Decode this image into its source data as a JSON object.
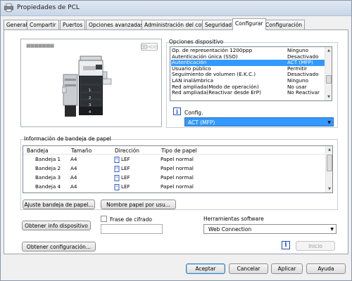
{
  "window": {
    "title": "Propiedades de PCL"
  },
  "tabs": [
    {
      "label": "General"
    },
    {
      "label": "Compartir"
    },
    {
      "label": "Puertos"
    },
    {
      "label": "Opciones avanzadas"
    },
    {
      "label": "Administración del color"
    },
    {
      "label": "Seguridad"
    },
    {
      "label": "Configurar"
    },
    {
      "label": "Configuración"
    }
  ],
  "active_tab": "Configurar",
  "preview": {
    "hdd_label": "HDD",
    "blurred_text": "■■■■■■■",
    "tray_numbers": [
      "1",
      "2",
      "3",
      "4"
    ]
  },
  "device_options": {
    "title": "Opciones dispositivo",
    "items": [
      {
        "name": "Op. de representación 1200ppp",
        "value": "Ninguno"
      },
      {
        "name": "Autenticación única (SSO)",
        "value": "Desactivado"
      },
      {
        "name": "Autenticación",
        "value": "ACT (MFP)"
      },
      {
        "name": "Usuario público",
        "value": "Permitir"
      },
      {
        "name": "Seguimiento de volumen (E.K.C.)",
        "value": "Desactivado"
      },
      {
        "name": "LAN inalámbrica",
        "value": "Ninguno"
      },
      {
        "name": "Red ampliada(Modo de operación)",
        "value": "No usar"
      },
      {
        "name": "Red ampliada(Reactivar desde ErP)",
        "value": "No Reactivar"
      }
    ],
    "selected_index": 2,
    "config_label": "Config.",
    "config_value": "ACT (MFP)"
  },
  "paper_tray": {
    "title": "Información de bandeja de papel",
    "columns": [
      "Bandeja",
      "Tamaño",
      "Dirección",
      "Tipo de papel"
    ],
    "rows": [
      {
        "tray": "Bandeja 1",
        "size": "A4",
        "direction": "LEF",
        "type": "Papel normal"
      },
      {
        "tray": "Bandeja 2",
        "size": "A4",
        "direction": "LEF",
        "type": "Papel normal"
      },
      {
        "tray": "Bandeja 3",
        "size": "A4",
        "direction": "LEF",
        "type": "Papel normal"
      },
      {
        "tray": "Bandeja 4",
        "size": "A4",
        "direction": "LEF",
        "type": "Papel normal"
      }
    ]
  },
  "buttons": {
    "adjust_tray": "Ajuste bandeja de papel...",
    "paper_name": "Nombre papel por usu...",
    "get_device_info": "Obtener info dispositivo",
    "get_config": "Obtener configuración...",
    "start": "Inicio",
    "ok": "Aceptar",
    "cancel": "Cancelar",
    "apply": "Aplicar",
    "help": "Ayuda"
  },
  "encryption": {
    "label": "Frase de cifrado",
    "checked": false,
    "value": ""
  },
  "software_tools": {
    "label": "Herramientas software",
    "value": "Web Connection"
  },
  "colors": {
    "selection": "#3399ff",
    "info_icon": "#1f4fbf"
  }
}
